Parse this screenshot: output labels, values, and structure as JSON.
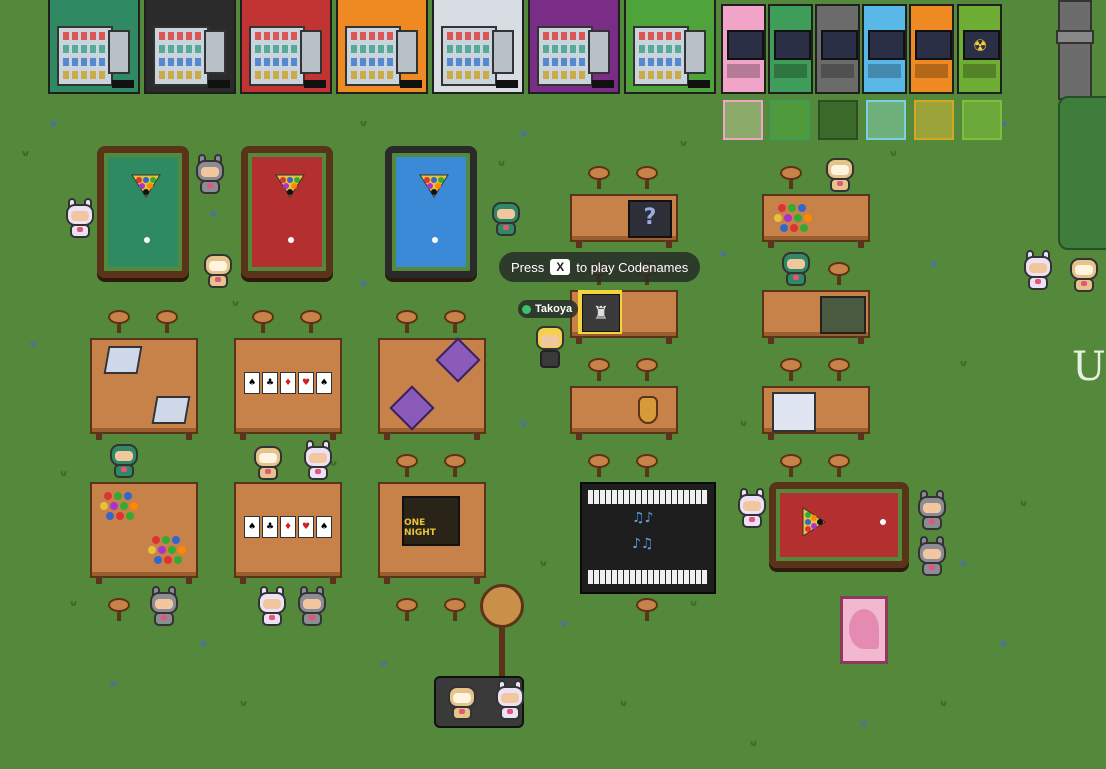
{
  "hud": {
    "prompt": {
      "prefix": "Press",
      "key": "X",
      "suffix": "to play Codenames"
    },
    "player_nametag": {
      "name": "Takoya",
      "status": "online",
      "status_color": "#3fbf6a"
    }
  },
  "world": {
    "background_color": "#54883a",
    "edge_sign_text": "Use",
    "vending_machine_colors": [
      "#2f8a63",
      "#2b2b2b",
      "#c23434",
      "#ef8a22",
      "#d7dde2",
      "#7a2d86",
      "#4ea43a"
    ],
    "arcade_machine_colors": [
      "#f2a4c8",
      "#3e9d58",
      "#6b6b6b",
      "#5ab8e8",
      "#ef8a22",
      "#6fae35"
    ],
    "color_swatches": [
      "#8caa6a",
      "#4f9a3a",
      "#3c6a2a",
      "#6fb07a",
      "#9aa33a",
      "#6aa83a"
    ],
    "pool_table_colors": [
      "#2e8a62",
      "#b42f2f",
      "#3a8ad8",
      "#b42f2f"
    ],
    "board_game_icons": [
      "question-block-icon",
      "codenames-icon",
      "marble-board-icon",
      "painting-icon",
      "spinning-top-icon",
      "blank-card-icon",
      "d20-die-icon",
      "playing-cards-icon",
      "one-night-icon",
      "piano-icon",
      "poster-icon"
    ],
    "one_night_box_text": "ONE NIGHT"
  }
}
